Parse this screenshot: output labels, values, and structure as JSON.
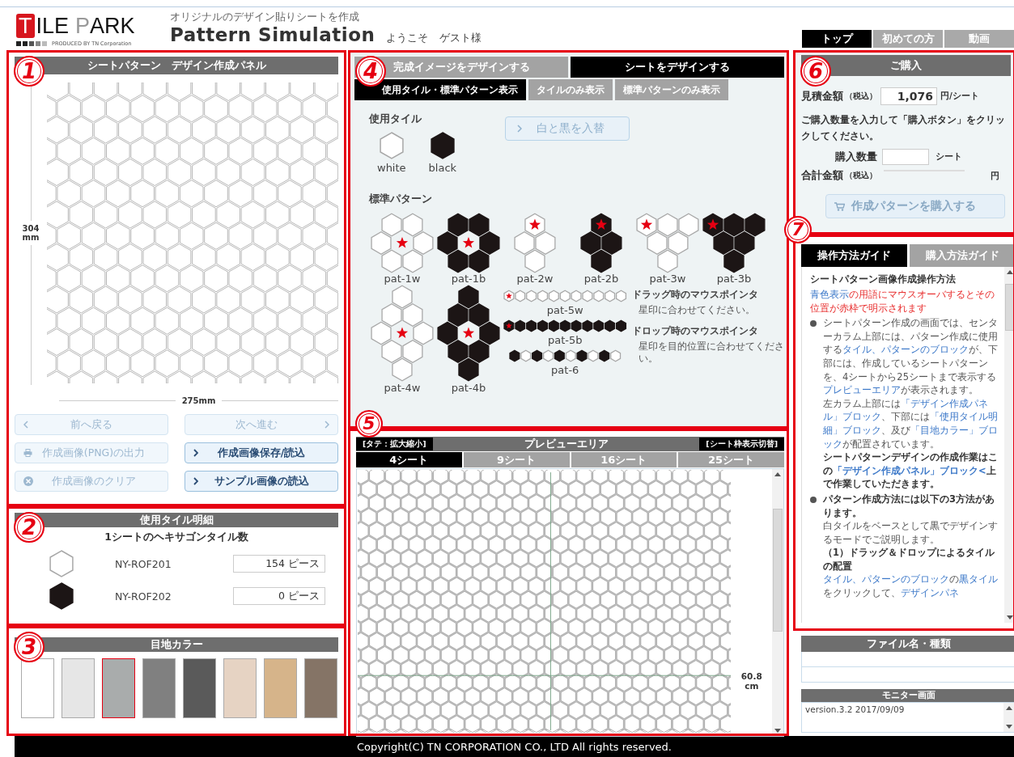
{
  "header": {
    "logo": {
      "initial": "T",
      "word_1": "ILE",
      "word_2": "P",
      "word_3": "ARK",
      "tagline": "PRODUCED BY TN Corporation"
    },
    "subtitle": "オリジナルのデザイン貼りシートを作成",
    "title": "Pattern Simulation",
    "welcome": "ようこそ",
    "user": "ゲスト様"
  },
  "nav_tabs": [
    {
      "label": "トップ",
      "selected": true
    },
    {
      "label": "初めての方",
      "selected": false
    },
    {
      "label": "動画",
      "selected": false
    }
  ],
  "design_panel": {
    "annotation": "1",
    "title": "シートパターン　デザイン作成パネル",
    "height_label": "304 mm",
    "width_label": "275mm",
    "buttons": [
      {
        "label": "前へ戻る",
        "kind": "back",
        "disabled": true
      },
      {
        "label": "次へ進む",
        "kind": "forward",
        "disabled": true
      },
      {
        "label": "作成画像(PNG)の出力",
        "kind": "print",
        "disabled": true
      },
      {
        "label": "作成画像保存/読込",
        "kind": "link",
        "disabled": false
      },
      {
        "label": "作成画像のクリア",
        "kind": "clear",
        "disabled": true
      },
      {
        "label": "サンプル画像の読込",
        "kind": "link",
        "disabled": false
      }
    ]
  },
  "tile_detail": {
    "annotation": "2",
    "title": "使用タイル明細",
    "subtitle": "1シートのヘキサゴンタイル数",
    "rows": [
      {
        "dark": false,
        "code": "NY-ROF201",
        "count": "154 ピース"
      },
      {
        "dark": true,
        "code": "NY-ROF202",
        "count": "0 ピース"
      }
    ]
  },
  "grout_color": {
    "annotation": "3",
    "title": "目地カラー",
    "swatches": [
      {
        "color": "#ffffff",
        "selected": false
      },
      {
        "color": "#e6e6e6",
        "selected": false
      },
      {
        "color": "#a9acac",
        "selected": true
      },
      {
        "color": "#808080",
        "selected": false
      },
      {
        "color": "#5a5a5a",
        "selected": false
      },
      {
        "color": "#e6d3c3",
        "selected": false
      },
      {
        "color": "#d6b48a",
        "selected": false
      },
      {
        "color": "#857466",
        "selected": false
      }
    ]
  },
  "pattern_panel": {
    "annotation": "4",
    "tabs": [
      {
        "label": "完成イメージをデザインする",
        "selected": false
      },
      {
        "label": "シートをデザインする",
        "selected": true
      }
    ],
    "subtabs": [
      {
        "label": "使用タイル・標準パターン表示",
        "selected": true
      },
      {
        "label": "タイルのみ表示",
        "selected": false
      },
      {
        "label": "標準パターンのみ表示",
        "selected": false
      }
    ],
    "tiles_heading": "使用タイル",
    "tiles": [
      {
        "dark": false,
        "label": "white"
      },
      {
        "dark": true,
        "label": "black"
      }
    ],
    "swap_button": {
      "label": "白と黒を入替",
      "disabled": true
    },
    "patterns_heading": "標準パターン",
    "patterns": [
      {
        "label": "pat-1w",
        "kind": "ring",
        "dark": false,
        "marked": true
      },
      {
        "label": "pat-1b",
        "kind": "ring",
        "dark": true,
        "marked": true
      },
      {
        "label": "pat-2w",
        "kind": "diamond",
        "dark": false,
        "marked": true
      },
      {
        "label": "pat-2b",
        "kind": "diamond",
        "dark": true,
        "marked": true
      },
      {
        "label": "pat-3w",
        "kind": "triangle",
        "dark": false,
        "marked": true
      },
      {
        "label": "pat-3b",
        "kind": "triangle",
        "dark": true,
        "marked": true
      },
      {
        "label": "pat-4w",
        "kind": "tall",
        "dark": false,
        "marked": true
      },
      {
        "label": "pat-4b",
        "kind": "tall",
        "dark": true,
        "marked": true
      },
      {
        "label": "pat-5w",
        "kind": "row",
        "dark": false,
        "marked": true
      },
      {
        "label": "pat-5b",
        "kind": "row",
        "dark": true,
        "marked": true
      },
      {
        "label": "pat-6",
        "kind": "alternating",
        "dark": true,
        "marked": false
      }
    ],
    "hints": [
      {
        "title": "ドラッグ時のマウスポインタ",
        "text": "星印に合わせてください。"
      },
      {
        "title": "ドロップ時のマウスポインタ",
        "text": "星印を目的位置に合わせてください。"
      }
    ]
  },
  "preview": {
    "annotation": "5",
    "zoom_button": "[タテ：拡大縮小]",
    "title": "プレビューエリア",
    "frame_button": "[シート枠表示切替]",
    "tabs": [
      {
        "label": "4シート",
        "selected": true
      },
      {
        "label": "9シート",
        "selected": false
      },
      {
        "label": "16シート",
        "selected": false
      },
      {
        "label": "25シート",
        "selected": false
      }
    ],
    "size_label": "60.8 cm"
  },
  "purchase": {
    "annotation": "6",
    "title": "ご購入",
    "estimate_label": "見積金額",
    "estimate_tax_note": "（税込）",
    "estimate": "1,076",
    "estimate_unit": "円/シート",
    "instruction": "ご購入数量を入力して「購入ボタン」をクリックしてください。",
    "quantity_label": "購入数量",
    "quantity_unit": "シート",
    "total_label": "合計金額",
    "total_tax_note": "（税込）",
    "total_unit": "円",
    "buy_button": {
      "label": "作成パターンを購入する",
      "disabled": true
    }
  },
  "guide": {
    "annotation": "7",
    "tabs": [
      {
        "label": "操作方法ガイド",
        "selected": true
      },
      {
        "label": "購入方法ガイド",
        "selected": false
      }
    ],
    "heading": "シートパターン画像作成操作方法",
    "paragraphs": [
      {
        "kind": "note",
        "bold": false,
        "segments": [
          {
            "kind": "term",
            "text": "青色表示"
          },
          {
            "kind": "alert",
            "text": "の用語にマウスオーバするとその位置が赤枠で明示されます"
          }
        ]
      },
      {
        "kind": "bullet",
        "bold": false,
        "segments": [
          {
            "kind": "plain",
            "text": "シートパターン作成の画面では、センターカラム上部には、パターン作成に使用する"
          },
          {
            "kind": "term",
            "text": "タイル、パターンのブロック"
          },
          {
            "kind": "plain",
            "text": "が、下部には、作成しているシートパターンを、4シートから25シートまで表示する"
          },
          {
            "kind": "term",
            "text": "プレビューエリア"
          },
          {
            "kind": "plain",
            "text": "が表示されます。"
          }
        ]
      },
      {
        "kind": "plain",
        "bold": false,
        "segments": [
          {
            "kind": "plain",
            "text": "左カラム上部には"
          },
          {
            "kind": "term",
            "text": "「デザイン作成パネル」ブロック"
          },
          {
            "kind": "plain",
            "text": "、下部には"
          },
          {
            "kind": "term",
            "text": "「使用タイル明細」ブロック"
          },
          {
            "kind": "plain",
            "text": "、及び"
          },
          {
            "kind": "term",
            "text": "「目地カラー」ブロック"
          },
          {
            "kind": "plain",
            "text": "が配置されています。"
          }
        ]
      },
      {
        "kind": "plain",
        "bold": true,
        "segments": [
          {
            "kind": "plain",
            "text": "シートパターンデザインの作成作業はこの"
          },
          {
            "kind": "term",
            "text": "「デザイン作成パネル」ブロック<"
          },
          {
            "kind": "plain",
            "text": "上で作業していただきます。"
          }
        ]
      },
      {
        "kind": "bullet",
        "bold": true,
        "segments": [
          {
            "kind": "plain",
            "text": "パターン作成方法には以下の3方法があります。"
          }
        ]
      },
      {
        "kind": "plain",
        "bold": false,
        "segments": [
          {
            "kind": "plain",
            "text": "白タイルをベースとして黒でデザインするモードでご説明します。"
          }
        ]
      },
      {
        "kind": "plain",
        "bold": true,
        "segments": [
          {
            "kind": "plain",
            "text": "（1）ドラッグ＆ドロップによるタイルの配置"
          }
        ]
      },
      {
        "kind": "plain",
        "bold": false,
        "segments": [
          {
            "kind": "term",
            "text": "タイル、パターンのブロック"
          },
          {
            "kind": "plain",
            "text": "の"
          },
          {
            "kind": "term",
            "text": "黒タイル"
          },
          {
            "kind": "plain",
            "text": "をクリックして、"
          },
          {
            "kind": "term",
            "text": "デザインパネ"
          }
        ]
      }
    ]
  },
  "files": {
    "title": "ファイル名・種類"
  },
  "monitor": {
    "title": "モニター画面",
    "value": "version.3.2 2017/09/09"
  },
  "footer": {
    "copyright": "Copyright(C) TN CORPORATION CO., LTD All rights reserved."
  }
}
